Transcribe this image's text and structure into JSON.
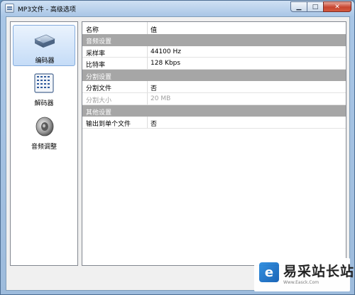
{
  "window": {
    "title": "MP3文件 - 高级选项",
    "buttons": {
      "minimize": "▁",
      "maximize": "□",
      "close": "✕"
    }
  },
  "nav": {
    "items": [
      {
        "label": "编码器",
        "icon": "encoder-box-icon",
        "selected": true
      },
      {
        "label": "解码器",
        "icon": "decoder-chip-icon",
        "selected": false
      },
      {
        "label": "音频调整",
        "icon": "speaker-icon",
        "selected": false
      }
    ]
  },
  "grid": {
    "headers": {
      "name": "名称",
      "value": "值"
    },
    "sections": [
      {
        "title": "音频设置",
        "rows": [
          {
            "name": "采样率",
            "value": "44100 Hz",
            "disabled": false
          },
          {
            "name": "比特率",
            "value": "128 Kbps",
            "disabled": false
          }
        ]
      },
      {
        "title": "分割设置",
        "rows": [
          {
            "name": "分割文件",
            "value": "否",
            "disabled": false
          },
          {
            "name": "分割大小",
            "value": "20 MB",
            "disabled": true
          }
        ]
      },
      {
        "title": "其他设置",
        "rows": [
          {
            "name": "输出到单个文件",
            "value": "否",
            "disabled": false
          }
        ]
      }
    ]
  },
  "watermark": {
    "logo_glyph": "e",
    "title": "易采站长站",
    "url": "Www.Easck.Com"
  },
  "colors": {
    "category_band": "#a6a6a6",
    "selected_item": "#c5dcf7",
    "close_button": "#c7452f"
  }
}
